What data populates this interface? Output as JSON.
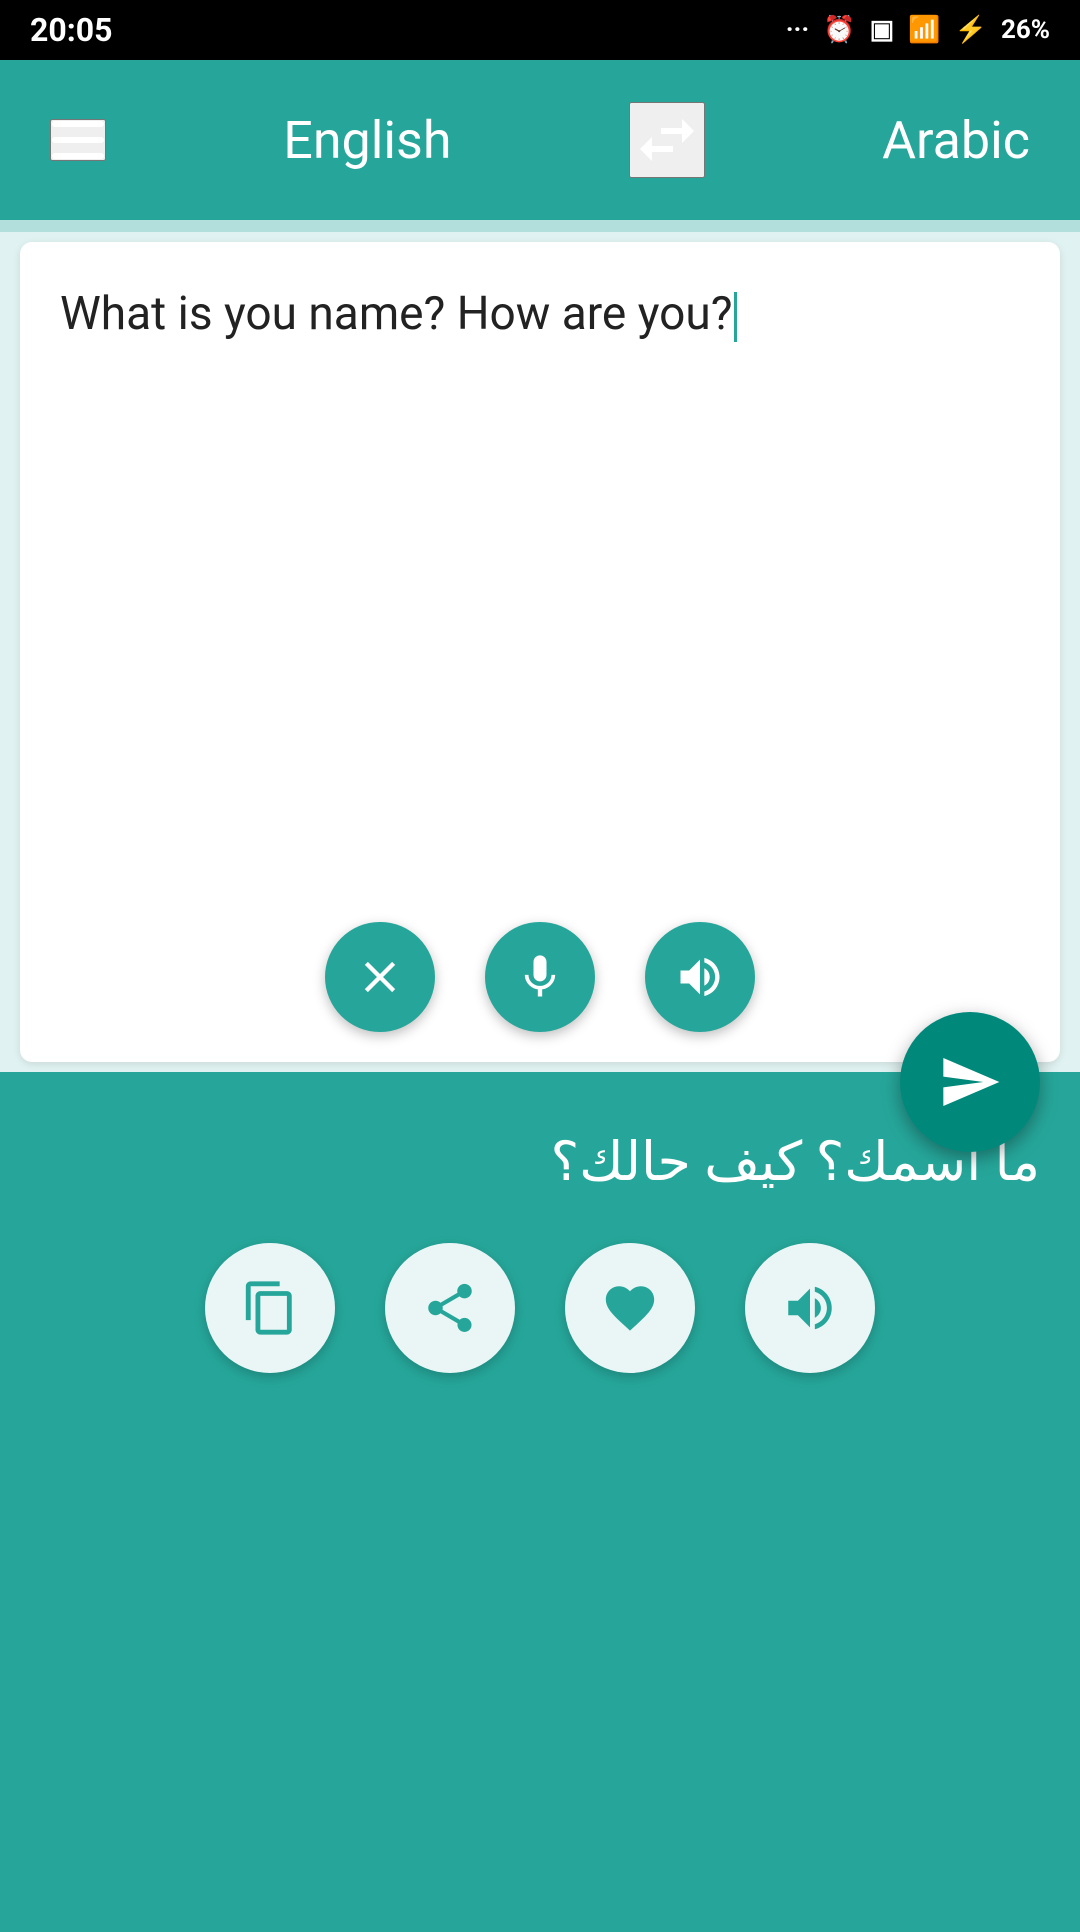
{
  "status_bar": {
    "time": "20:05",
    "battery_percent": "26%"
  },
  "nav": {
    "menu_label": "menu",
    "source_language": "English",
    "swap_label": "swap languages",
    "target_language": "Arabic"
  },
  "input_panel": {
    "text": "What is you name? How are you?",
    "clear_btn_label": "Clear",
    "mic_btn_label": "Microphone",
    "speak_btn_label": "Speak",
    "translate_btn_label": "Translate"
  },
  "output_panel": {
    "text": "ما اسمك؟ كيف حالك؟",
    "copy_btn_label": "Copy",
    "share_btn_label": "Share",
    "favorite_btn_label": "Favorite",
    "speak_btn_label": "Speak"
  }
}
